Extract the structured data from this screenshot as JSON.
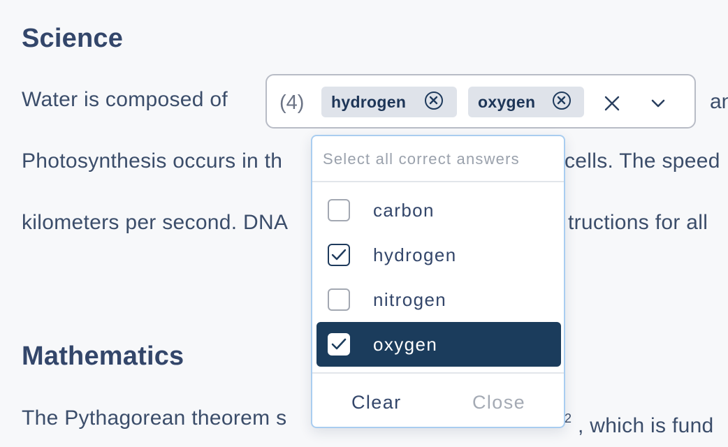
{
  "sections": {
    "science": {
      "heading": "Science",
      "line1_before": "Water is composed of",
      "line1_after": "an",
      "line2": "Photosynthesis occurs in the plant cells. The speed",
      "line2_left": "Photosynthesis occurs in th",
      "line2_right": "cells. The speed",
      "line3_left": "kilometers per second. DNA",
      "line3_right": "tructions for all"
    },
    "mathematics": {
      "heading": "Mathematics",
      "line1_left": "The Pythagorean theorem s",
      "line1_sup": "2",
      "line1_right": ", which is fund"
    }
  },
  "multiselect": {
    "count_label": "(4)",
    "chips": [
      {
        "label": "hydrogen"
      },
      {
        "label": "oxygen"
      }
    ],
    "clear_icon": "close-icon",
    "caret_icon": "chevron-down-icon"
  },
  "dropdown": {
    "search_placeholder": "Select all correct answers",
    "options": [
      {
        "label": "carbon",
        "checked": false
      },
      {
        "label": "hydrogen",
        "checked": true
      },
      {
        "label": "nitrogen",
        "checked": false
      },
      {
        "label": "oxygen",
        "checked": true,
        "highlighted": true
      }
    ],
    "footer": {
      "clear_label": "Clear",
      "close_label": "Close"
    }
  },
  "colors": {
    "highlight_bg": "#1b3c5c",
    "chip_bg": "#dfe3ea",
    "dropdown_border": "#a9cdf0",
    "page_bg": "#f7f8fa"
  }
}
